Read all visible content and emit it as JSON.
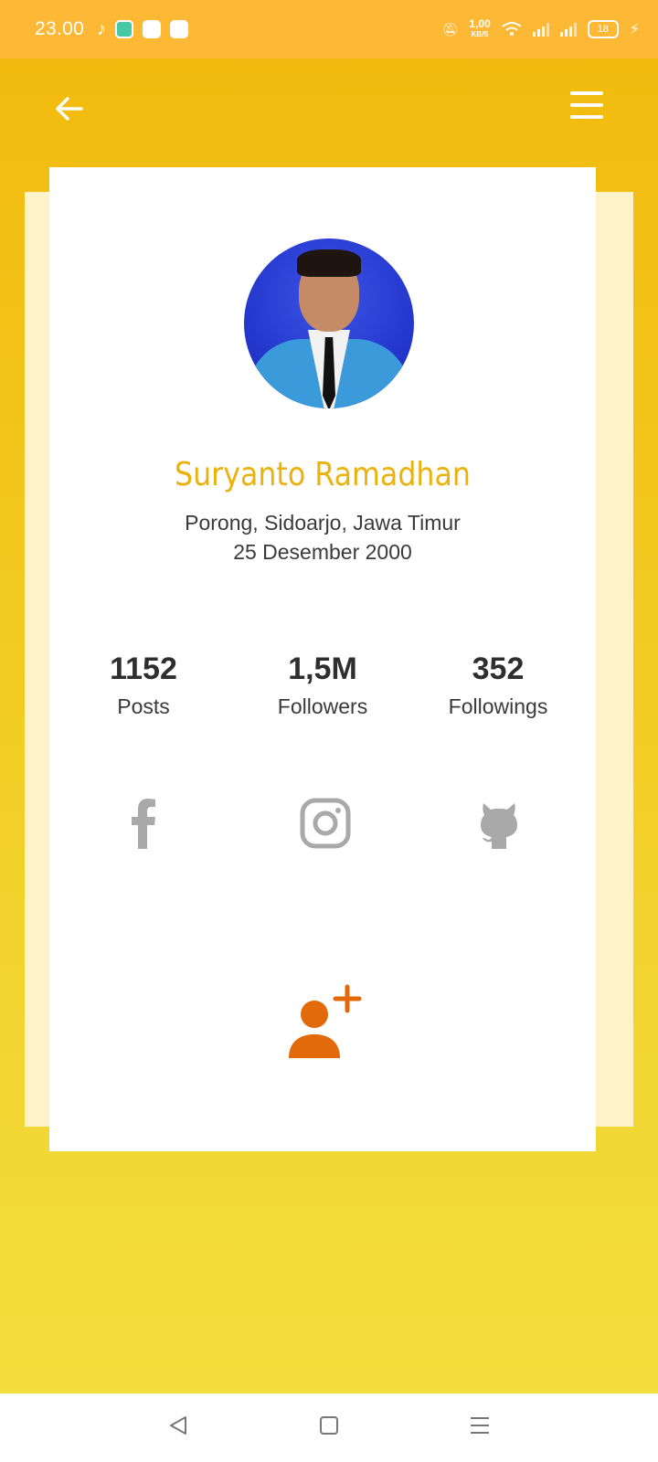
{
  "status_bar": {
    "time": "23.00",
    "net_speed_value": "1,00",
    "net_speed_unit": "KB/S",
    "battery": "18"
  },
  "profile": {
    "name": "Suryanto Ramadhan",
    "address": "Porong, Sidoarjo, Jawa Timur",
    "birth_date": "25 Desember 2000"
  },
  "stats": [
    {
      "value": "1152",
      "label": "Posts"
    },
    {
      "value": "1,5M",
      "label": "Followers"
    },
    {
      "value": "352",
      "label": "Followings"
    }
  ],
  "icons": {
    "back": "arrow-left-icon",
    "menu": "hamburger-menu-icon",
    "social": [
      "facebook-icon",
      "instagram-icon",
      "github-icon"
    ],
    "add_user": "add-user-icon",
    "nav": [
      "nav-back-icon",
      "nav-home-icon",
      "nav-recents-icon"
    ]
  },
  "colors": {
    "status_bar": "#fdb836",
    "name": "#ebb20e",
    "add_user": "#e26a0a",
    "social_icons": "#a9a9a9"
  }
}
